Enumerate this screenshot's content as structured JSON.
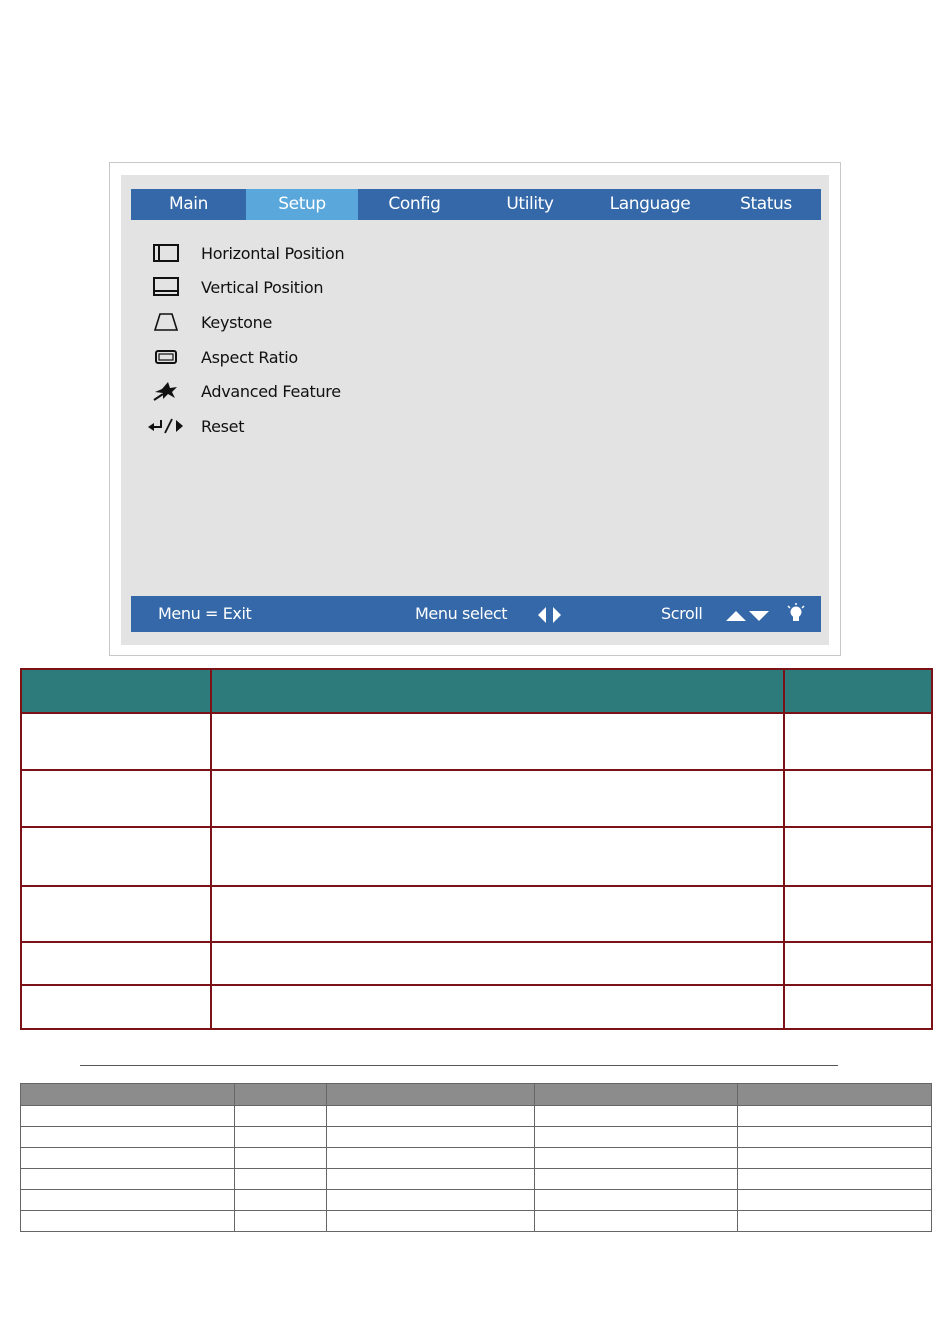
{
  "tabs": [
    {
      "label": "Main",
      "active": false
    },
    {
      "label": "Setup",
      "active": true
    },
    {
      "label": "Config",
      "active": false
    },
    {
      "label": "Utility",
      "active": false
    },
    {
      "label": "Language",
      "active": false
    },
    {
      "label": "Status",
      "active": false
    }
  ],
  "menu_items": [
    {
      "label": "Horizontal Position",
      "icon": "horizontal-position-icon"
    },
    {
      "label": "Vertical Position",
      "icon": "vertical-position-icon"
    },
    {
      "label": "Keystone",
      "icon": "keystone-icon"
    },
    {
      "label": "Aspect Ratio",
      "icon": "aspect-ratio-icon"
    },
    {
      "label": "Advanced Feature",
      "icon": "advanced-feature-icon"
    },
    {
      "label": "Reset",
      "icon": "reset-icon"
    }
  ],
  "footer": {
    "exit_hint": "Menu = Exit",
    "select_hint": "Menu select",
    "scroll_hint": "Scroll"
  },
  "colors": {
    "bar_blue": "#3468a8",
    "active_tab": "#5aa7dc",
    "panel_gray": "#e3e3e3",
    "table_header": "#2e7b7c",
    "table_border": "#7a1218",
    "grid_header": "#8c8c8c"
  }
}
